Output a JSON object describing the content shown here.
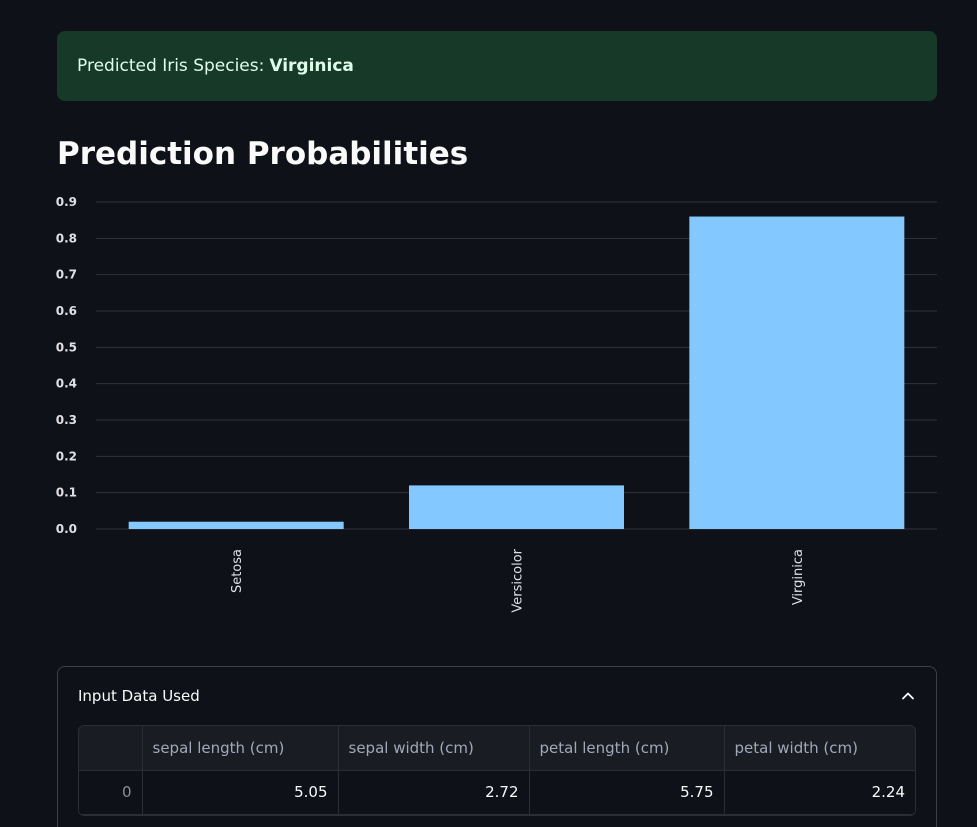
{
  "alert": {
    "prefix": "Predicted Iris Species:",
    "species": "Virginica"
  },
  "section_title": "Prediction Probabilities",
  "chart_data": {
    "type": "bar",
    "categories": [
      "Setosa",
      "Versicolor",
      "Virginica"
    ],
    "values": [
      0.02,
      0.12,
      0.86
    ],
    "yticks": [
      "0.0",
      "0.1",
      "0.2",
      "0.3",
      "0.4",
      "0.5",
      "0.6",
      "0.7",
      "0.8",
      "0.9"
    ],
    "ylim": [
      0,
      0.9
    ],
    "grid": true,
    "bar_color": "#83c9ff",
    "grid_color": "#31333f"
  },
  "input_data": {
    "title": "Input Data Used",
    "columns": [
      "",
      "sepal length (cm)",
      "sepal width (cm)",
      "petal length (cm)",
      "petal width (cm)"
    ],
    "rows": [
      [
        "0",
        "5.05",
        "2.72",
        "5.75",
        "2.24"
      ]
    ]
  }
}
